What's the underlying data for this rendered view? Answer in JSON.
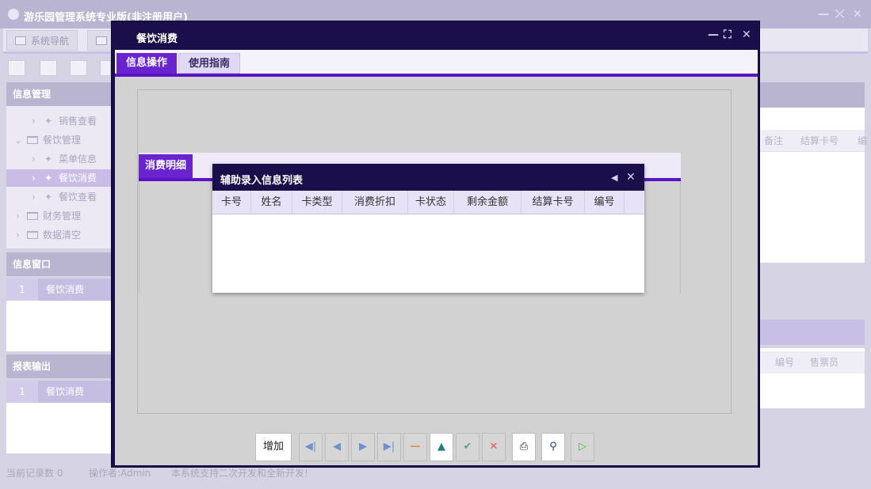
{
  "app": {
    "title": "游乐园管理系统专业版(非注册用户)",
    "tabs": [
      {
        "label": "系统导航"
      }
    ],
    "panels": {
      "info_management": "信息管理",
      "info_window": "信息窗口",
      "report_output": "报表输出"
    },
    "tree": [
      {
        "label": "销售查看"
      },
      {
        "label": "餐饮管理"
      },
      {
        "label": "菜单信息"
      },
      {
        "label": "餐饮消费"
      },
      {
        "label": "餐饮查看"
      },
      {
        "label": "财务管理"
      },
      {
        "label": "数据清空"
      }
    ],
    "info_window_row": {
      "num": "1",
      "label": "餐饮消费"
    },
    "report_row": {
      "num": "1",
      "label": "餐饮消费"
    },
    "right_cols_1": [
      "备注",
      "结算卡号",
      "编"
    ],
    "right_cols_2": [
      "编号",
      "售票员"
    ],
    "status": {
      "record_count": "当前记录数 0",
      "operator": "操作者:Admin",
      "notice": "本系统支持二次开发和全新开发!"
    }
  },
  "dialog": {
    "title": "餐饮消费",
    "tabs": [
      {
        "label": "信息操作"
      },
      {
        "label": "使用指南"
      }
    ],
    "detail_tab": "消费明细",
    "nav": {
      "add": "增加"
    }
  },
  "popup": {
    "title": "辅助录入信息列表",
    "columns": [
      "卡号",
      "姓名",
      "卡类型",
      "消费折扣",
      "卡状态",
      "剩余金额",
      "结算卡号",
      "编号"
    ]
  },
  "colors": {
    "dialog_bg": "#1a0f4a",
    "accent": "#6a24cf",
    "accent_line": "#5a14c4",
    "header_bg": "#e8e2f6"
  }
}
